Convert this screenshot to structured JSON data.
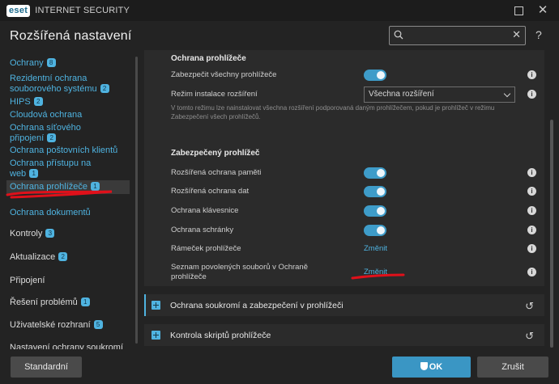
{
  "app": {
    "logo": "eset",
    "title": "INTERNET SECURITY"
  },
  "page": {
    "title": "Rozšířená nastavení",
    "help": "?"
  },
  "search": {
    "placeholder": "",
    "value": ""
  },
  "sidebar": {
    "items": [
      {
        "label": "Ochrany",
        "badge": "8"
      },
      {
        "label": "Rezidentní ochrana souborového systému",
        "badge": "2"
      },
      {
        "label": "HIPS",
        "badge": "2"
      },
      {
        "label": "Cloudová ochrana",
        "badge": ""
      },
      {
        "label": "Ochrana síťového připojení",
        "badge": "2"
      },
      {
        "label": "Ochrana poštovních klientů",
        "badge": ""
      },
      {
        "label": "Ochrana přístupu na web",
        "badge": "1"
      },
      {
        "label": "Ochrana prohlížeče",
        "badge": "1"
      },
      {
        "label": "Ochrana dokumentů",
        "badge": ""
      },
      {
        "label": "Kontroly",
        "badge": "3"
      },
      {
        "label": "Aktualizace",
        "badge": "2"
      },
      {
        "label": "Připojení",
        "badge": ""
      },
      {
        "label": "Řešení problémů",
        "badge": "1"
      },
      {
        "label": "Uživatelské rozhraní",
        "badge": "5"
      },
      {
        "label": "Nastavení ochrany soukromí",
        "badge": ""
      }
    ]
  },
  "browser_protection": {
    "heading": "Ochrana prohlížeče",
    "secure_all_label": "Zabezpečit všechny prohlížeče",
    "install_mode_label": "Režim instalace rozšíření",
    "install_mode_value": "Všechna rozšíření",
    "install_mode_desc": "V tomto režimu lze nainstalovat všechna rozšíření podporovaná daným prohlížečem, pokud je prohlížeč v režimu Zabezpečení všech prohlížečů."
  },
  "secure_browser": {
    "heading": "Zabezpečený prohlížeč",
    "rows": [
      {
        "label": "Rozšířená ochrana paměti",
        "control": "toggle",
        "on": true
      },
      {
        "label": "Rozšířená ochrana dat",
        "control": "toggle",
        "on": true
      },
      {
        "label": "Ochrana klávesnice",
        "control": "toggle",
        "on": true
      },
      {
        "label": "Ochrana schránky",
        "control": "toggle",
        "on": true
      },
      {
        "label": "Rámeček prohlížeče",
        "control": "link",
        "value": "Změnit"
      },
      {
        "label": "Seznam povolených souborů v Ochraně prohlížeče",
        "control": "link",
        "value": "Změnit"
      }
    ]
  },
  "collapsed_sections": [
    {
      "label": "Ochrana soukromí a zabezpečení v prohlížeči"
    },
    {
      "label": "Kontrola skriptů prohlížeče"
    }
  ],
  "footer": {
    "default_label": "Standardní",
    "ok_label": "OK",
    "cancel_label": "Zrušit"
  },
  "colors": {
    "accent": "#4fb3e0",
    "toggle_on": "#3e9cc9",
    "annotation": "#e0101a"
  }
}
